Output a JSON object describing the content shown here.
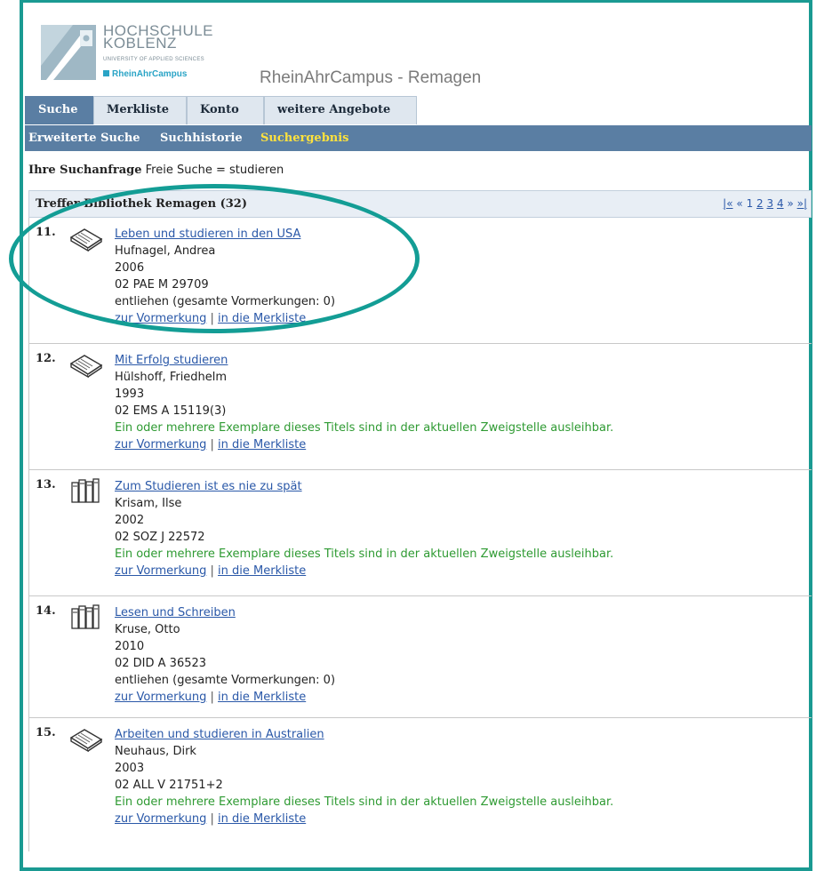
{
  "logo": {
    "line1": "HOCHSCHULE",
    "line2": "KOBLENZ",
    "line3": "UNIVERSITY OF APPLIED SCIENCES",
    "line4": "RheinAhrCampus"
  },
  "campus_title": "RheinAhrCampus - Remagen",
  "tabs": [
    {
      "label": "Suche",
      "active": true
    },
    {
      "label": "Merkliste",
      "active": false
    },
    {
      "label": "Konto",
      "active": false
    },
    {
      "label": "weitere Angebote",
      "active": false
    }
  ],
  "subnav": [
    {
      "label": "Erweiterte Suche"
    },
    {
      "label": "Suchhistorie"
    },
    {
      "label": "Suchergebnis"
    }
  ],
  "query": {
    "label": "Ihre Suchanfrage",
    "text": "Freie Suche = studieren"
  },
  "results": {
    "title": "Treffer Bibliothek Remagen (32)",
    "pager": {
      "first": "|«",
      "prev": "«",
      "pages": [
        "1",
        "2",
        "3",
        "4"
      ],
      "next": "»",
      "last": "»|"
    },
    "items": [
      {
        "num": "11.",
        "icon": "book-icon",
        "title": "Leben und studieren in den USA",
        "author": "Hufnagel, Andrea",
        "year": "2006",
        "signature": "02 PAE M 29709",
        "status": "entliehen (gesamte Vormerkungen: 0)",
        "status_type": "lent",
        "action1": "zur Vormerkung",
        "separator": "|",
        "action2": "in die Merkliste"
      },
      {
        "num": "12.",
        "icon": "book-icon",
        "title": "Mit Erfolg studieren",
        "author": "Hülshoff, Friedhelm",
        "year": "1993",
        "signature": "02 EMS A 15119(3)",
        "status": "Ein oder mehrere Exemplare dieses Titels sind in der aktuellen Zweigstelle ausleihbar.",
        "status_type": "available",
        "action1": "zur Vormerkung",
        "separator": "|",
        "action2": "in die Merkliste"
      },
      {
        "num": "13.",
        "icon": "volumes-icon",
        "title": "Zum Studieren ist es nie zu spät",
        "author": "Krisam, Ilse",
        "year": "2002",
        "signature": "02 SOZ J 22572",
        "status": "Ein oder mehrere Exemplare dieses Titels sind in der aktuellen Zweigstelle ausleihbar.",
        "status_type": "available",
        "action1": "zur Vormerkung",
        "separator": "|",
        "action2": "in die Merkliste"
      },
      {
        "num": "14.",
        "icon": "volumes-icon",
        "title": "Lesen und Schreiben",
        "author": "Kruse, Otto",
        "year": "2010",
        "signature": "02 DID A 36523",
        "status": "entliehen (gesamte Vormerkungen: 0)",
        "status_type": "lent",
        "action1": "zur Vormerkung",
        "separator": "|",
        "action2": "in die Merkliste"
      },
      {
        "num": "15.",
        "icon": "book-icon",
        "title": "Arbeiten und studieren in Australien",
        "author": "Neuhaus, Dirk",
        "year": "2003",
        "signature": "02 ALL V 21751+2",
        "status": "Ein oder mehrere Exemplare dieses Titels sind in der aktuellen Zweigstelle ausleihbar.",
        "status_type": "available",
        "action1": "zur Vormerkung",
        "separator": "|",
        "action2": "in die Merkliste"
      }
    ]
  },
  "colors": {
    "frame": "#1a9a92",
    "nav_bar": "#5a7ea3",
    "current_subnav": "#ffe23d",
    "link": "#2a58a8",
    "available": "#2e9a32"
  }
}
